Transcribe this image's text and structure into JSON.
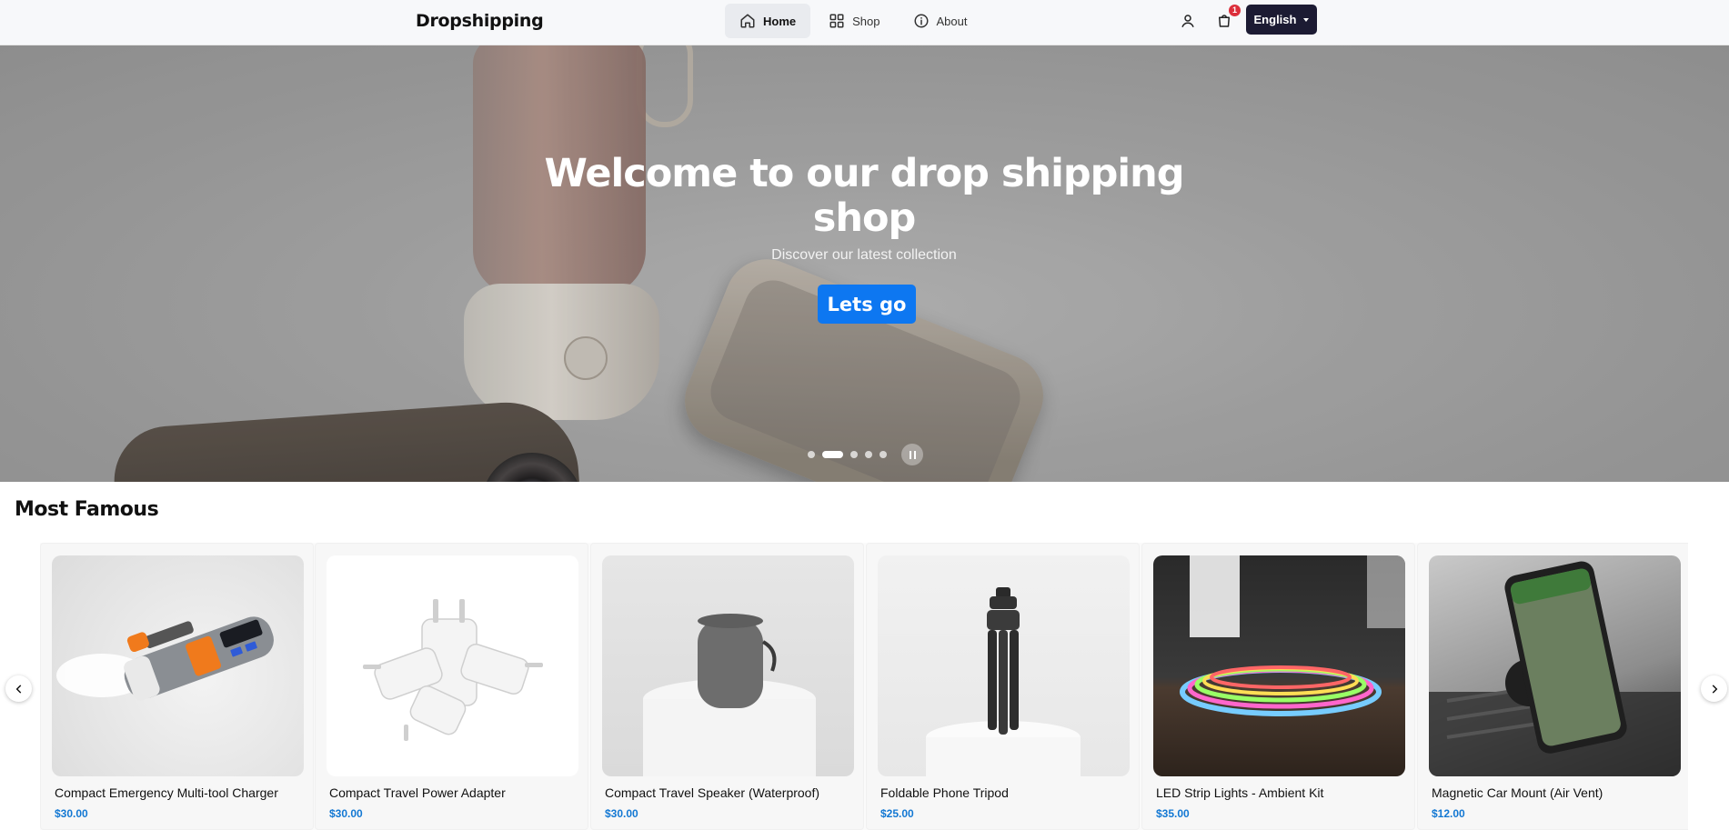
{
  "header": {
    "brand": "Dropshipping",
    "nav": [
      {
        "label": "Home",
        "icon": "home-icon",
        "active": true
      },
      {
        "label": "Shop",
        "icon": "grid-icon",
        "active": false
      },
      {
        "label": "About",
        "icon": "info-icon",
        "active": false
      }
    ],
    "cart_count": "1",
    "language": "English",
    "user_icon": "user-icon",
    "cart_icon": "cart-icon"
  },
  "hero": {
    "title": "Welcome to our drop shipping shop",
    "subtitle": "Discover our latest collection",
    "button_label": "Lets go",
    "slide_count": 5,
    "active_slide": 2
  },
  "most_famous": {
    "title": "Most Famous",
    "products": [
      {
        "name": "Compact Emergency Multi-tool Charger",
        "price": "$30.00",
        "image": "flashlight-charger"
      },
      {
        "name": "Compact Travel Power Adapter",
        "price": "$30.00",
        "image": "travel-adapter"
      },
      {
        "name": "Compact Travel Speaker (Waterproof)",
        "price": "$30.00",
        "image": "speaker"
      },
      {
        "name": "Foldable Phone Tripod",
        "price": "$25.00",
        "image": "tripod"
      },
      {
        "name": "LED Strip Lights - Ambient Kit",
        "price": "$35.00",
        "image": "led-strip"
      },
      {
        "name": "Magnetic Car Mount (Air Vent)",
        "price": "$12.00",
        "image": "car-mount"
      }
    ]
  },
  "colors": {
    "primary": "#0d77f1",
    "price": "#1378d3",
    "language_button": "#1c1b33",
    "badge": "#dc2f3b"
  }
}
